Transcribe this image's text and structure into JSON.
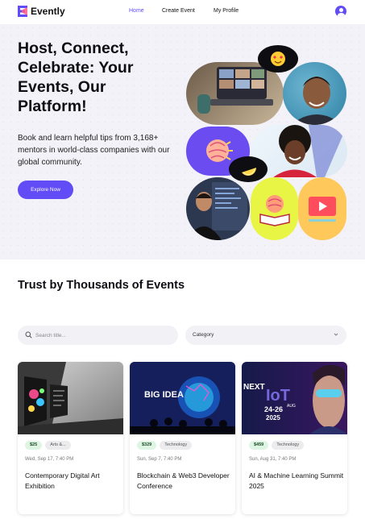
{
  "app": {
    "name": "Evently",
    "brand_color": "#624cf5"
  },
  "nav": {
    "items": [
      {
        "label": "Home",
        "active": true
      },
      {
        "label": "Create Event",
        "active": false
      },
      {
        "label": "My Profile",
        "active": false
      }
    ],
    "avatar_icon": "user-avatar-icon"
  },
  "hero": {
    "title": "Host, Connect, Celebrate: Your Events, Our Platform!",
    "subtitle": "Book and learn helpful tips from 3,168+ mentors in world-class companies with our global community.",
    "cta_label": "Explore Now",
    "collage_icons": [
      "heart-eyes-emoji-icon",
      "lemon-slice-icon",
      "brain-icon",
      "brain-book-icon",
      "video-play-icon"
    ]
  },
  "events_section": {
    "title": "Trust by Thousands of Events",
    "search": {
      "placeholder": "Search title...",
      "value": ""
    },
    "category": {
      "selected": "Category"
    }
  },
  "events": [
    {
      "price": "$25",
      "category": "Arts &...",
      "date": "Wed, Sep 17, 7:40 PM",
      "title": "Contemporary Digital Art Exhibition"
    },
    {
      "price": "$329",
      "category": "Technology",
      "date": "Sun, Sep 7, 7:40 PM",
      "title": "Blockchain & Web3 Developer Conference"
    },
    {
      "price": "$459",
      "category": "Technology",
      "date": "Sun, Aug 31, 7:40 PM",
      "title": "AI & Machine Learning Summit 2025"
    }
  ],
  "event_image_text": {
    "e2": "BIG IDEA",
    "e3_a": "NEXT",
    "e3_b": "IoT",
    "e3_c": "24-26",
    "e3_d": "AUG",
    "e3_e": "2025"
  }
}
